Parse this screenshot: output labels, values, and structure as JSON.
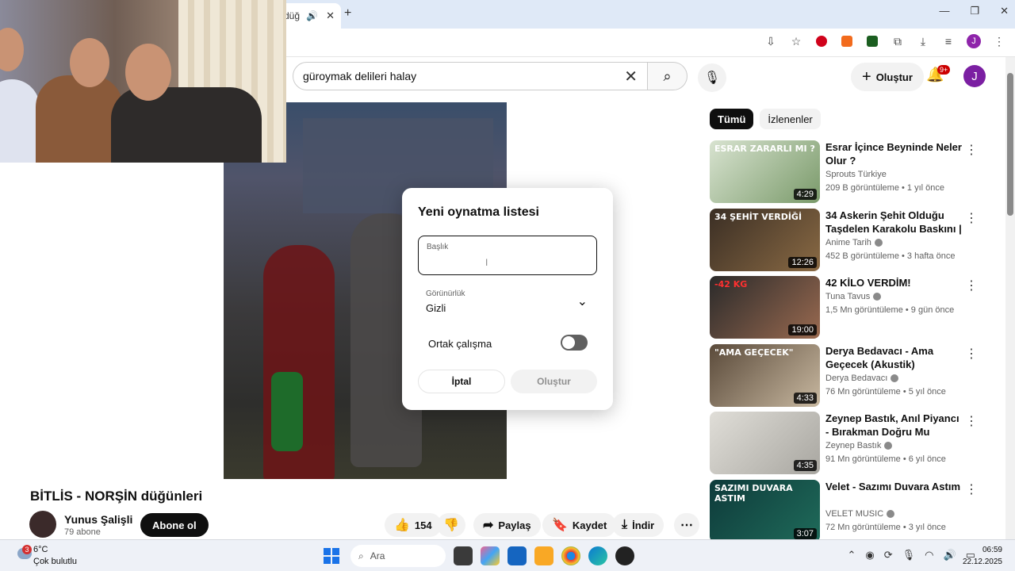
{
  "browser": {
    "tab_close": "✕",
    "new_tab": "+",
    "win_controls": [
      "—",
      "❐",
      "✕"
    ]
  },
  "youtube": {
    "search_value": "güroymak delileri halay",
    "create_label": "Oluştur",
    "notif_badge": "9+",
    "avatar_letter": "J",
    "video_title": "BİTLİS - NORŞİN düğünleri",
    "channel_name": "Yunus Şalişli",
    "channel_subs": "79 abone",
    "subscribe_label": "Abone ol",
    "actions": {
      "like_count": "154",
      "share_label": "Paylaş",
      "save_label": "Kaydet",
      "download_label": "İndir"
    },
    "chips": [
      "Tümü",
      "İzlenenler"
    ],
    "recommendations": [
      {
        "title": "Esrar İçince Beyninde Neler Olur ?",
        "channel": "Sprouts Türkiye",
        "verified": false,
        "meta": "209 B görüntüleme • 1 yıl önce",
        "duration": "4:29",
        "thumb_text": "ESRAR ZARARLI MI ?",
        "colors": [
          "#d8e3d0",
          "#7a9a6a"
        ]
      },
      {
        "title": "34 Askerin Şehit Olduğu Taşdelen Karakolu Baskını | ...",
        "channel": "Anime Tarih",
        "verified": true,
        "meta": "452 B görüntüleme • 3 hafta önce",
        "duration": "12:26",
        "thumb_text": "34 ŞEHİT VERDİĞİ",
        "colors": [
          "#3a2e24",
          "#8a6a44"
        ]
      },
      {
        "title": "42 KİLO VERDİM!",
        "channel": "Tuna Tavus",
        "verified": true,
        "meta": "1,5 Mn görüntüleme • 9 gün önce",
        "duration": "19:00",
        "thumb_text": "-42 KG",
        "colors": [
          "#2a2a2a",
          "#9a6a50"
        ]
      },
      {
        "title": "Derya Bedavacı - Ama Geçecek (Akustik)",
        "channel": "Derya Bedavacı",
        "verified": true,
        "meta": "76 Mn görüntüleme • 5 yıl önce",
        "duration": "4:33",
        "thumb_text": "\"AMA GEÇECEK\"",
        "colors": [
          "#5a4a3a",
          "#c8b8a0"
        ]
      },
      {
        "title": "Zeynep Bastık, Anıl Piyancı - Bırakman Doğru Mu (Official ...",
        "channel": "Zeynep Bastık",
        "verified": true,
        "meta": "91 Mn görüntüleme • 6 yıl önce",
        "duration": "4:35",
        "thumb_text": "",
        "colors": [
          "#e0ded8",
          "#a8a6a0"
        ]
      },
      {
        "title": "Velet - Sazımı Duvara Astım",
        "channel": "VELET MUSIC",
        "verified": true,
        "meta": "72 Mn görüntüleme • 3 yıl önce",
        "duration": "3:07",
        "thumb_text": "SAZIMI DUVARA ASTIM",
        "colors": [
          "#0e3a3a",
          "#1f6b5a"
        ]
      }
    ]
  },
  "modal": {
    "title": "Yeni oynatma listesi",
    "title_field_label": "Başlık",
    "title_field_value": "",
    "visibility_label": "Görünürlük",
    "visibility_value": "Gizli",
    "collab_label": "Ortak çalışma",
    "collab_enabled": false,
    "cancel_label": "İptal",
    "create_label": "Oluştur"
  },
  "taskbar": {
    "weather_badge": "3",
    "weather_temp": "6°C",
    "weather_desc": "Çok bulutlu",
    "search_label": "Ara",
    "time": "06:59",
    "date": "22.12.2025"
  }
}
